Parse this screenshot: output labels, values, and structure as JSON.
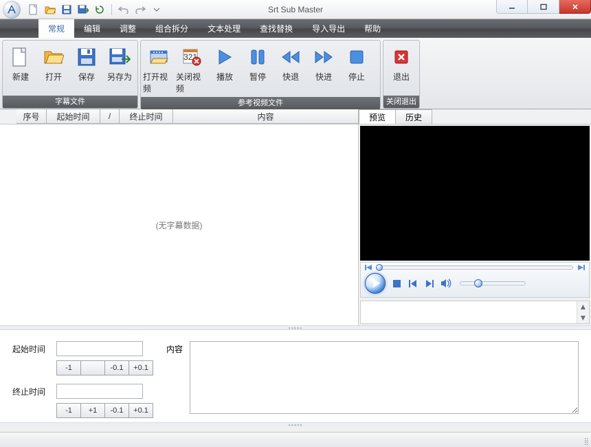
{
  "window": {
    "title": "Srt Sub Master"
  },
  "menu": {
    "items": [
      "常规",
      "编辑",
      "调整",
      "组合拆分",
      "文本处理",
      "查找替换",
      "导入导出",
      "帮助"
    ],
    "active_index": 0
  },
  "ribbon": {
    "groups": [
      {
        "label": "字幕文件",
        "buttons": [
          {
            "key": "new",
            "label": "新建"
          },
          {
            "key": "open",
            "label": "打开"
          },
          {
            "key": "save",
            "label": "保存"
          },
          {
            "key": "saveas",
            "label": "另存为"
          }
        ]
      },
      {
        "label": "参考视频文件",
        "buttons": [
          {
            "key": "openvideo",
            "label": "打开视频"
          },
          {
            "key": "closevideo",
            "label": "关闭视频"
          },
          {
            "key": "play",
            "label": "播放"
          },
          {
            "key": "pause",
            "label": "暂停"
          },
          {
            "key": "rewind",
            "label": "快退"
          },
          {
            "key": "forward",
            "label": "快进"
          },
          {
            "key": "stop",
            "label": "停止"
          }
        ]
      },
      {
        "label": "关闭退出",
        "buttons": [
          {
            "key": "exit",
            "label": "退出"
          }
        ]
      }
    ]
  },
  "columns": {
    "index": "序号",
    "start": "起始时间",
    "sep": "/",
    "end": "终止时间",
    "content": "内容"
  },
  "empty_text": "(无字幕数据)",
  "preview_tabs": {
    "preview": "预览",
    "history": "历史",
    "active": "preview"
  },
  "editor": {
    "start_label": "起始时间",
    "end_label": "终止时间",
    "content_label": "内容",
    "start_value": "",
    "end_value": "",
    "content_value": "",
    "start_adjust": [
      "-1",
      "",
      "-0.1",
      "+0.1"
    ],
    "end_adjust": [
      "-1",
      "+1",
      "-0.1",
      "+0.1"
    ]
  }
}
